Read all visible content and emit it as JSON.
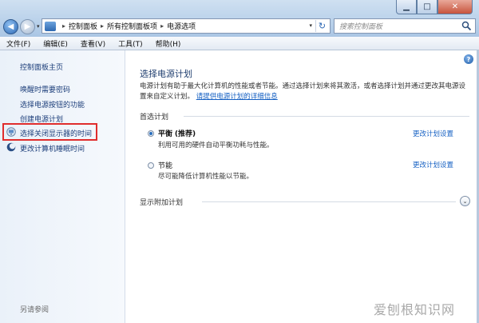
{
  "window": {
    "buttons": {
      "minimize": "▁",
      "maximize": "□",
      "close": "✕"
    }
  },
  "nav": {
    "back_glyph": "◀",
    "forward_glyph": "▶",
    "dropdown_glyph": "▾"
  },
  "address": {
    "breadcrumbs": [
      "控制面板",
      "所有控制面板项",
      "电源选项"
    ],
    "separator": "▸",
    "dropdown_glyph": "▾",
    "refresh_glyph": "↻"
  },
  "search": {
    "placeholder": "搜索控制面板"
  },
  "menu": [
    "文件(F)",
    "编辑(E)",
    "查看(V)",
    "工具(T)",
    "帮助(H)"
  ],
  "sidebar": {
    "home": "控制面板主页",
    "items": [
      "唤醒时需要密码",
      "选择电源按钮的功能",
      "创建电源计划",
      "选择关闭显示器的时间",
      "更改计算机睡眠时间"
    ],
    "also_see": "另请参阅"
  },
  "main": {
    "help_glyph": "?",
    "title": "选择电源计划",
    "description": "电源计划有助于最大化计算机的性能或者节能。通过选择计划来将其激活，或者选择计划并通过更改其电源设置来自定义计划。",
    "description_link": "请提供电源计划的详细信息",
    "preferred_label": "首选计划",
    "plans": [
      {
        "name": "平衡",
        "tag": "(推荐)",
        "desc": "利用可用的硬件自动平衡功耗与性能。",
        "selected": true,
        "change": "更改计划设置"
      },
      {
        "name": "节能",
        "tag": "",
        "desc": "尽可能降低计算机性能以节能。",
        "selected": false,
        "change": "更改计划设置"
      }
    ],
    "extra_label": "显示附加计划",
    "expand_glyph": "⌄"
  },
  "watermark": "爱刨根知识网",
  "colors": {
    "link": "#1560c3",
    "highlight": "#e02d2d",
    "title": "#1e3d6e"
  }
}
